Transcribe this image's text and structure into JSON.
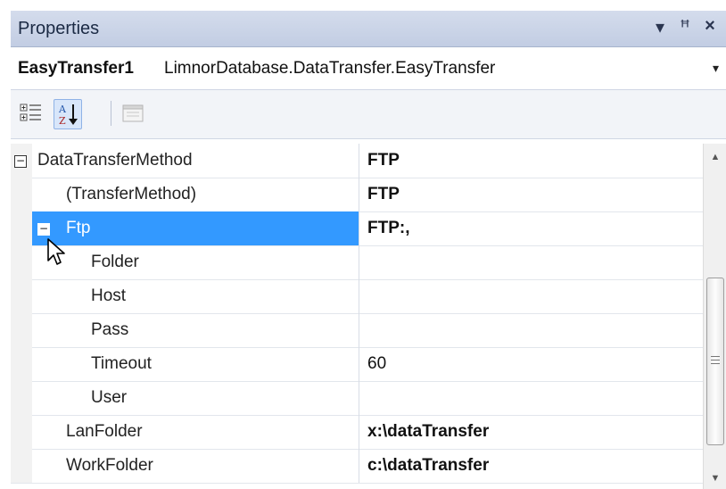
{
  "panel": {
    "title": "Properties",
    "buttons": {
      "dropdown": "▾",
      "pin": "ꟸ",
      "close": "×"
    }
  },
  "object_selector": {
    "name": "EasyTransfer1",
    "type": "LimnorDatabase.DataTransfer.EasyTransfer",
    "dropdown_glyph": "▾"
  },
  "toolbar": {
    "buttons": [
      {
        "name": "categorized",
        "icon": "categorized-icon",
        "pressed": false
      },
      {
        "name": "alphabetical",
        "icon": "alphabetical-icon",
        "pressed": true
      },
      {
        "name": "property-pages",
        "icon": "property-pages-icon",
        "pressed": false
      }
    ]
  },
  "properties": [
    {
      "name": "DataTransferMethod",
      "value": "FTP",
      "bold": true,
      "indent": 0,
      "expander": "minus",
      "selected": false
    },
    {
      "name": "(TransferMethod)",
      "value": "FTP",
      "bold": true,
      "indent": 1,
      "expander": null,
      "selected": false
    },
    {
      "name": "Ftp",
      "value": "FTP:,",
      "bold": true,
      "indent": 1,
      "expander": "minus",
      "selected": true
    },
    {
      "name": "Folder",
      "value": "",
      "bold": false,
      "indent": 2,
      "expander": null,
      "selected": false
    },
    {
      "name": "Host",
      "value": "",
      "bold": false,
      "indent": 2,
      "expander": null,
      "selected": false
    },
    {
      "name": "Pass",
      "value": "",
      "bold": false,
      "indent": 2,
      "expander": null,
      "selected": false
    },
    {
      "name": "Timeout",
      "value": "60",
      "bold": false,
      "indent": 2,
      "expander": null,
      "selected": false
    },
    {
      "name": "User",
      "value": "",
      "bold": false,
      "indent": 2,
      "expander": null,
      "selected": false
    },
    {
      "name": "LanFolder",
      "value": "x:\\dataTransfer",
      "bold": true,
      "indent": 1,
      "expander": null,
      "selected": false
    },
    {
      "name": "WorkFolder",
      "value": "c:\\dataTransfer",
      "bold": true,
      "indent": 1,
      "expander": null,
      "selected": false
    }
  ],
  "scrollbar": {
    "up_glyph": "▲",
    "down_glyph": "▼"
  },
  "colors": {
    "selection": "#3399ff",
    "title_bar": "#c8d2e6"
  }
}
